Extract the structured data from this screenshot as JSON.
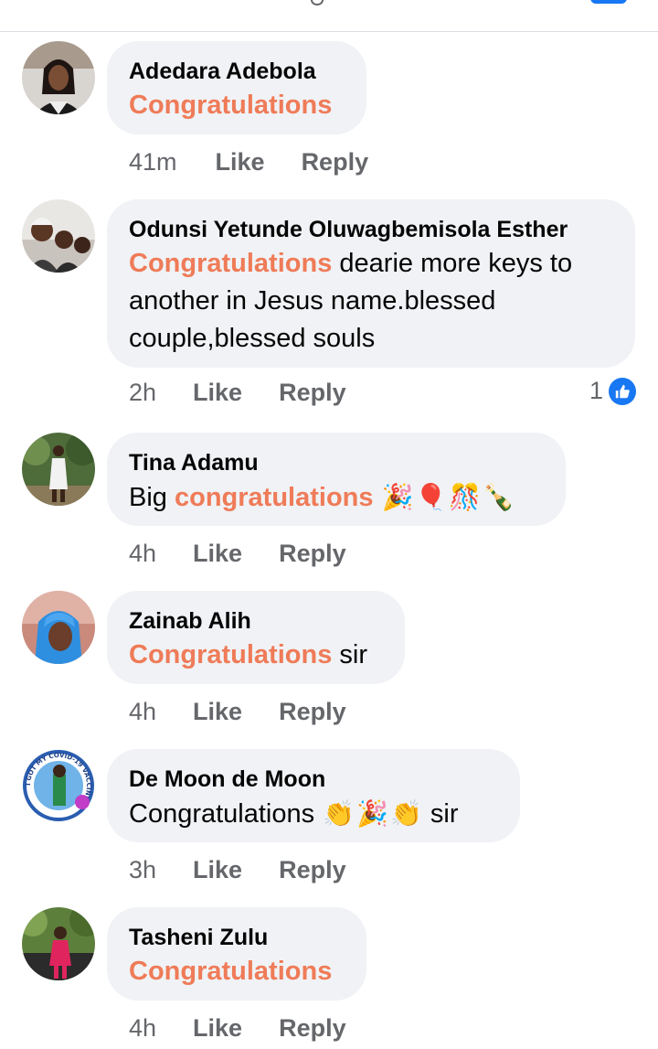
{
  "comments": [
    {
      "author": "Adedara Adebola",
      "highlight": "Congratulations",
      "text_after": "",
      "time": "41m",
      "like_label": "Like",
      "reply_label": "Reply"
    },
    {
      "author": "Odunsi Yetunde Oluwagbemisola Esther",
      "highlight": "Congratulations",
      "line1_after": " dearie more keys to",
      "line2": "another in Jesus name.blessed",
      "line3": "couple,blessed souls",
      "time": "2h",
      "like_label": "Like",
      "reply_label": "Reply",
      "reaction_count": "1"
    },
    {
      "author": "Tina Adamu",
      "text_before": "Big ",
      "highlight": "congratulations",
      "emojis": [
        "🎉",
        "🎈",
        "🎊",
        "🍾"
      ],
      "time": "4h",
      "like_label": "Like",
      "reply_label": "Reply"
    },
    {
      "author": "Zainab Alih",
      "highlight": "Congratulations",
      "text_after": " sir",
      "time": "4h",
      "like_label": "Like",
      "reply_label": "Reply"
    },
    {
      "author": "De Moon de Moon",
      "text_before": "Congratulations ",
      "emojis": [
        "👏",
        "🎉",
        "👏"
      ],
      "text_after": " sir",
      "avatar_ring_text": "I GOT MY COVID-19 VACCINE",
      "time": "3h",
      "like_label": "Like",
      "reply_label": "Reply"
    },
    {
      "author": "Tasheni Zulu",
      "highlight": "Congratulations",
      "text_after": "",
      "time": "4h",
      "like_label": "Like",
      "reply_label": "Reply"
    }
  ],
  "colors": {
    "highlight": "#ef7b58",
    "bubble": "#f0f2f5",
    "meta": "#65676b",
    "like_blue": "#1877f2"
  }
}
